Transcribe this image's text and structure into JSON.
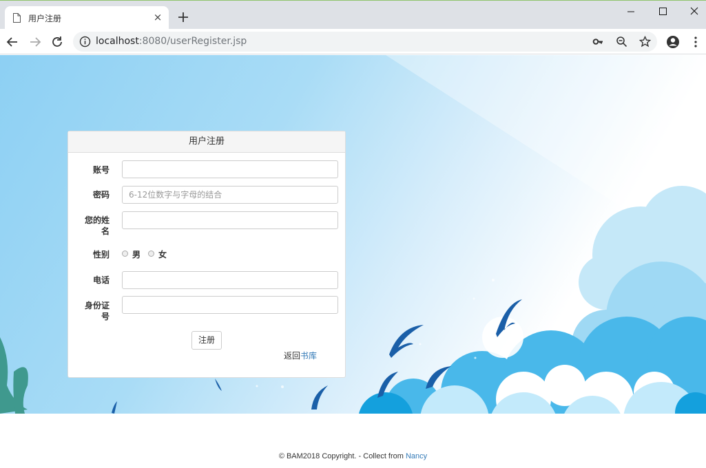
{
  "browser": {
    "tab_title": "用户注册",
    "tab_close": "×",
    "url_host": "localhost",
    "url_rest": ":8080/userRegister.jsp"
  },
  "form": {
    "heading": "用户注册",
    "account_label": "账号",
    "account_value": "",
    "password_label": "密码",
    "password_placeholder": "6-12位数字与字母的结合",
    "name_label_line1": "您的姓",
    "name_label_line2": "名",
    "name_value": "",
    "gender_label": "性别",
    "gender_male": "男",
    "gender_female": "女",
    "phone_label": "电话",
    "phone_value": "",
    "id_label_line1": "身份证",
    "id_label_line2": "号",
    "id_value": "",
    "submit_label": "注册",
    "back_prefix": "返回",
    "back_link": "书库"
  },
  "footer": {
    "copyright": "© BAM2018 Copyright. - Collect from ",
    "author_link": "Nancy"
  },
  "colors": {
    "link": "#337ab7",
    "sky": "#8dd0f3",
    "bird": "#1a5fa8"
  },
  "icons": [
    "document-icon",
    "close-icon",
    "plus-icon",
    "minimize-icon",
    "maximize-icon",
    "window-close-icon",
    "back-arrow-icon",
    "forward-arrow-icon",
    "reload-icon",
    "info-icon",
    "key-icon",
    "zoom-icon",
    "star-icon",
    "profile-icon",
    "kebab-menu-icon"
  ]
}
